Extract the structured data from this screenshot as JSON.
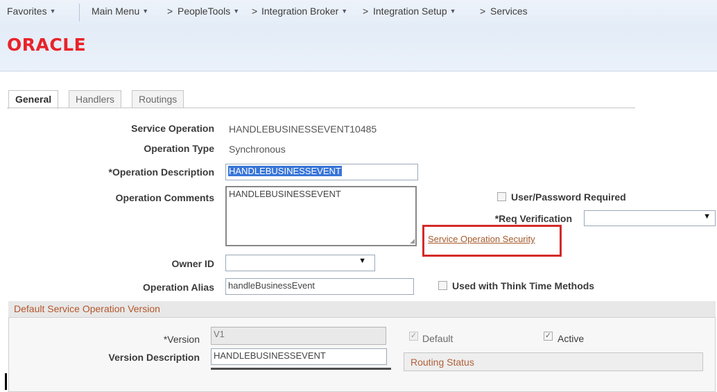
{
  "nav": {
    "favorites": "Favorites",
    "main_menu": "Main Menu",
    "breadcrumb": [
      {
        "label": "PeopleTools",
        "has_menu": true
      },
      {
        "label": "Integration Broker",
        "has_menu": true
      },
      {
        "label": "Integration Setup",
        "has_menu": true
      },
      {
        "label": "Services",
        "has_menu": false
      }
    ],
    "breadcrumb_separator": ">"
  },
  "brand": {
    "logo_text": "ORACLE",
    "logo_color": "#e8232a"
  },
  "tabs": [
    {
      "label": "General",
      "active": true
    },
    {
      "label": "Handlers",
      "active": false
    },
    {
      "label": "Routings",
      "active": false
    }
  ],
  "form": {
    "service_operation": {
      "label": "Service Operation",
      "value": "HANDLEBUSINESSEVENT10485"
    },
    "operation_type": {
      "label": "Operation Type",
      "value": "Synchronous"
    },
    "operation_description": {
      "label": "*Operation Description",
      "value": "HANDLEBUSINESSEVENT",
      "selected": true
    },
    "operation_comments": {
      "label": "Operation Comments",
      "value": "HANDLEBUSINESSEVENT"
    },
    "owner_id": {
      "label": "Owner ID",
      "value": ""
    },
    "operation_alias": {
      "label": "Operation Alias",
      "value": "handleBusinessEvent"
    },
    "user_password_required": {
      "label": "User/Password Required",
      "checked": false
    },
    "req_verification": {
      "label": "*Req Verification",
      "value": ""
    },
    "service_operation_security": {
      "label": "Service Operation Security"
    },
    "used_with_think_time": {
      "label": "Used with Think Time Methods",
      "checked": false
    }
  },
  "version_group": {
    "title": "Default Service Operation Version",
    "version": {
      "label": "*Version",
      "value": "V1"
    },
    "version_description": {
      "label": "Version Description",
      "value": "HANDLEBUSINESSEVENT"
    },
    "default": {
      "label": "Default",
      "checked": true
    },
    "active": {
      "label": "Active",
      "checked": true
    },
    "routing_status": "Routing Status"
  },
  "colors": {
    "link": "#a45a2c",
    "highlight_border": "#d42a2a",
    "selection": "#3875d7"
  }
}
